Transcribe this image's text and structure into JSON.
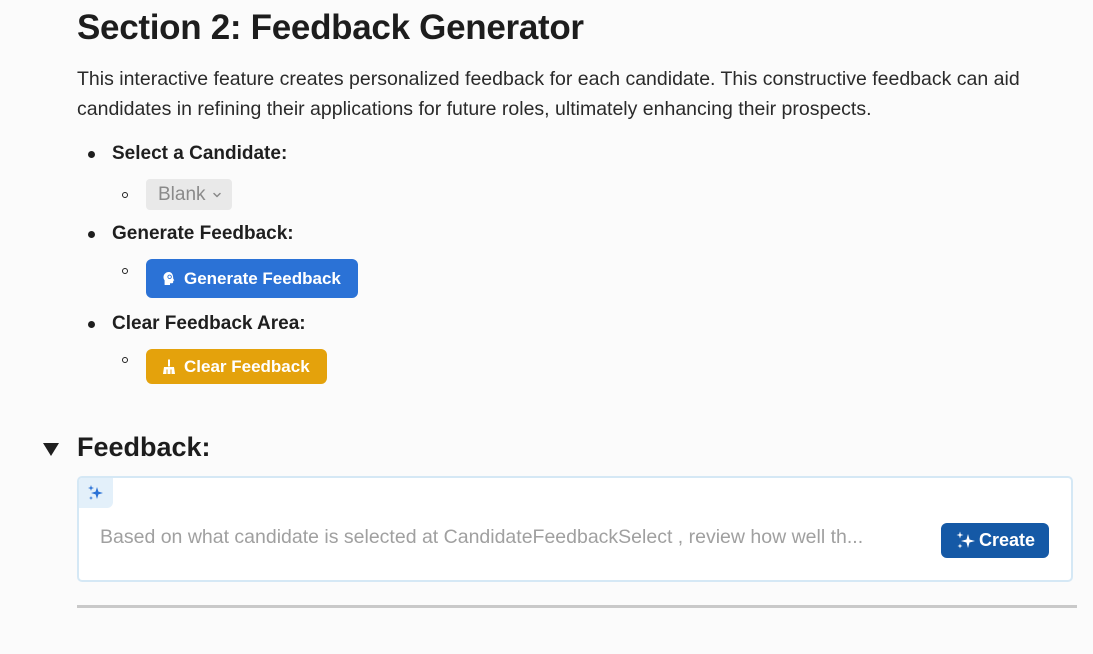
{
  "section": {
    "title": "Section 2: Feedback Generator",
    "intro": "This interactive feature creates personalized feedback for each candidate. This constructive feedback can aid candidates in refining their applications for future roles, ultimately enhancing their prospects."
  },
  "steps": [
    {
      "label": "Select a Candidate:",
      "control": {
        "type": "select",
        "value": "Blank",
        "icon": "chevron-down-icon"
      }
    },
    {
      "label": "Generate Feedback:",
      "control": {
        "type": "button",
        "label": "Generate Feedback",
        "icon": "brain-bulb-icon",
        "color": "#2b72d6"
      }
    },
    {
      "label": "Clear Feedback Area:",
      "control": {
        "type": "button",
        "label": "Clear Feedback",
        "icon": "broom-icon",
        "color": "#e4a20c"
      }
    }
  ],
  "feedback": {
    "heading": "Feedback:",
    "expanded": true,
    "ai_block": {
      "icon": "sparkles-icon",
      "prompt": "Based on what candidate is selected at CandidateFeedbackSelect , review how well th...",
      "create_label": "Create",
      "create_color": "#1559a6"
    }
  }
}
